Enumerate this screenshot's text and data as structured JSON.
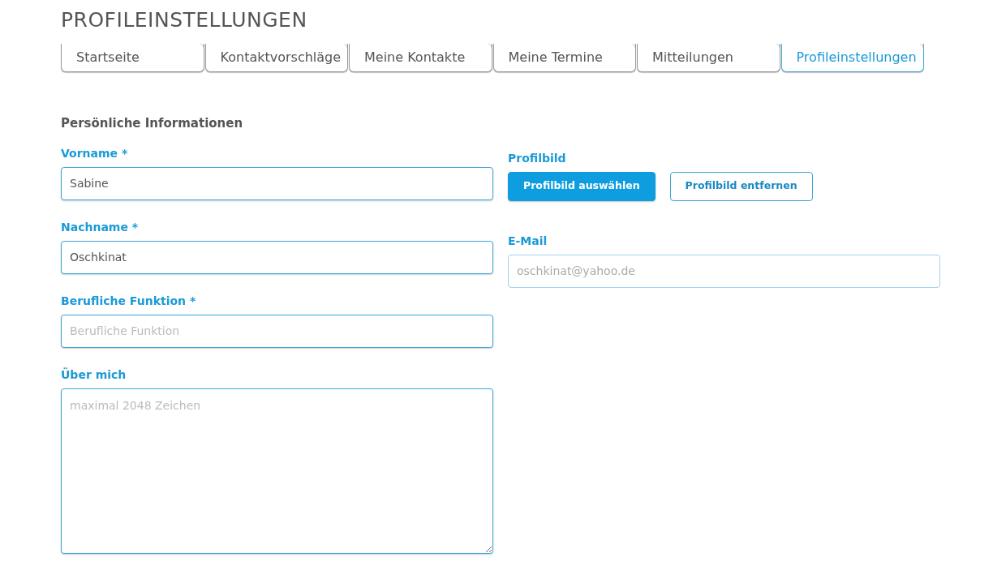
{
  "page_title": "PROFILEINSTELLUNGEN",
  "tabs": [
    {
      "label": "Startseite",
      "selected": false
    },
    {
      "label": "Kontaktvorschläge",
      "selected": false
    },
    {
      "label": "Meine Kontakte",
      "selected": false
    },
    {
      "label": "Meine Termine",
      "selected": false
    },
    {
      "label": "Mitteilungen",
      "selected": false
    },
    {
      "label": "Profileinstellungen",
      "selected": true
    }
  ],
  "section_title": "Persönliche Informationen",
  "left_fields": [
    {
      "kind": "input",
      "label": "Vorname *",
      "value": "Sabine"
    },
    {
      "kind": "input",
      "label": "Nachname *",
      "value": "Oschkinat"
    },
    {
      "kind": "input",
      "label": "Berufliche Funktion *",
      "placeholder": "Berufliche Funktion"
    },
    {
      "kind": "textarea",
      "label": "Über mich",
      "placeholder": "maximal 2048 Zeichen"
    }
  ],
  "profile_picture": {
    "label": "Profilbild",
    "buttons": [
      {
        "label": "Profilbild auswählen",
        "kind": "primary"
      },
      {
        "label": "Profilbild entfernen",
        "kind": "outline"
      }
    ]
  },
  "email": {
    "label": "E-Mail",
    "value": "oschkinat@yahoo.de",
    "disabled": true
  }
}
